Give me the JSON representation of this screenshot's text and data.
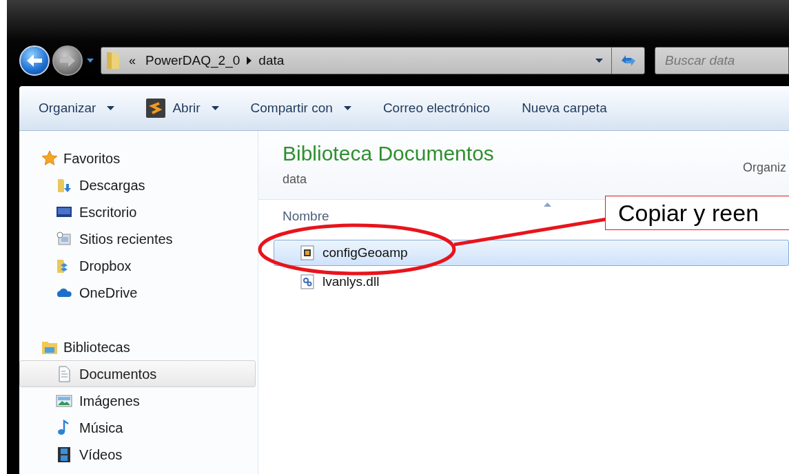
{
  "address": {
    "prefix": "«",
    "path": [
      "PowerDAQ_2_0",
      "data"
    ]
  },
  "search": {
    "placeholder": "Buscar data"
  },
  "toolbar": [
    {
      "label": "Organizar",
      "dropdown": true,
      "kind": "plain"
    },
    {
      "label": "Abrir",
      "dropdown": true,
      "kind": "app"
    },
    {
      "label": "Compartir con",
      "dropdown": true,
      "kind": "plain"
    },
    {
      "label": "Correo electrónico",
      "dropdown": false,
      "kind": "plain"
    },
    {
      "label": "Nueva carpeta",
      "dropdown": false,
      "kind": "plain"
    }
  ],
  "sidebar": [
    {
      "label": "Favoritos",
      "kind": "star",
      "children": [
        {
          "label": "Descargas",
          "kind": "downloads",
          "selected": false
        },
        {
          "label": "Escritorio",
          "kind": "desktop",
          "selected": false
        },
        {
          "label": "Sitios recientes",
          "kind": "recent",
          "selected": false
        },
        {
          "label": "Dropbox",
          "kind": "dropbox",
          "selected": false
        },
        {
          "label": "OneDrive",
          "kind": "cloud",
          "selected": false
        }
      ]
    },
    {
      "label": "Bibliotecas",
      "kind": "library",
      "children": [
        {
          "label": "Documentos",
          "kind": "document",
          "selected": true
        },
        {
          "label": "Imágenes",
          "kind": "image",
          "selected": false
        },
        {
          "label": "Música",
          "kind": "music",
          "selected": false
        },
        {
          "label": "Vídeos",
          "kind": "video",
          "selected": false
        }
      ]
    }
  ],
  "content": {
    "title": "Biblioteca Documentos",
    "subtitle": "data",
    "arrange_label": "Organiz",
    "columns": [
      "Nombre"
    ],
    "files": [
      {
        "name": "configGeoamp",
        "kind": "app",
        "selected": true
      },
      {
        "name": "lvanlys.dll",
        "kind": "dll",
        "selected": false
      }
    ]
  },
  "annotation": {
    "text": "Copiar y reen"
  }
}
